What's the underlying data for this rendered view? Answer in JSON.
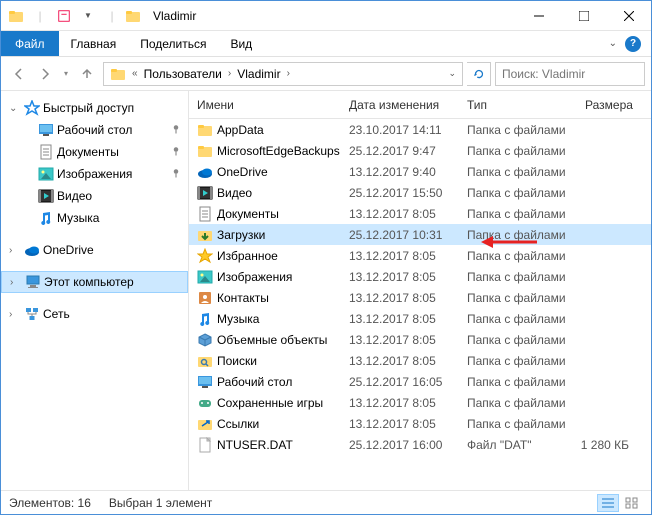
{
  "title": "Vladimir",
  "ribbon": {
    "file": "Файл",
    "tabs": [
      "Главная",
      "Поделиться",
      "Вид"
    ]
  },
  "breadcrumb": {
    "segments": [
      "Пользователи",
      "Vladimir"
    ]
  },
  "search": {
    "placeholder": "Поиск: Vladimir"
  },
  "sidebar": {
    "quick_access": "Быстрый доступ",
    "items": [
      {
        "label": "Рабочий стол",
        "pin": true,
        "icon": "desktop"
      },
      {
        "label": "Документы",
        "pin": true,
        "icon": "documents"
      },
      {
        "label": "Изображения",
        "pin": true,
        "icon": "pictures"
      },
      {
        "label": "Видео",
        "pin": false,
        "icon": "videos"
      },
      {
        "label": "Музыка",
        "pin": false,
        "icon": "music"
      }
    ],
    "onedrive": "OneDrive",
    "this_pc": "Этот компьютер",
    "network": "Сеть"
  },
  "columns": {
    "name": "Имени",
    "date": "Дата изменения",
    "type": "Тип",
    "size": "Размера"
  },
  "rows": [
    {
      "name": "AppData",
      "date": "23.10.2017 14:11",
      "type": "Папка с файлами",
      "size": "",
      "icon": "folder"
    },
    {
      "name": "MicrosoftEdgeBackups",
      "date": "25.12.2017 9:47",
      "type": "Папка с файлами",
      "size": "",
      "icon": "folder"
    },
    {
      "name": "OneDrive",
      "date": "13.12.2017 9:40",
      "type": "Папка с файлами",
      "size": "",
      "icon": "onedrive"
    },
    {
      "name": "Видео",
      "date": "25.12.2017 15:50",
      "type": "Папка с файлами",
      "size": "",
      "icon": "videos"
    },
    {
      "name": "Документы",
      "date": "13.12.2017 8:05",
      "type": "Папка с файлами",
      "size": "",
      "icon": "documents"
    },
    {
      "name": "Загрузки",
      "date": "25.12.2017 10:31",
      "type": "Папка с файлами",
      "size": "",
      "icon": "downloads",
      "selected": true
    },
    {
      "name": "Избранное",
      "date": "13.12.2017 8:05",
      "type": "Папка с файлами",
      "size": "",
      "icon": "favorites"
    },
    {
      "name": "Изображения",
      "date": "13.12.2017 8:05",
      "type": "Папка с файлами",
      "size": "",
      "icon": "pictures"
    },
    {
      "name": "Контакты",
      "date": "13.12.2017 8:05",
      "type": "Папка с файлами",
      "size": "",
      "icon": "contacts"
    },
    {
      "name": "Музыка",
      "date": "13.12.2017 8:05",
      "type": "Папка с файлами",
      "size": "",
      "icon": "music"
    },
    {
      "name": "Объемные объекты",
      "date": "13.12.2017 8:05",
      "type": "Папка с файлами",
      "size": "",
      "icon": "3dobjects"
    },
    {
      "name": "Поиски",
      "date": "13.12.2017 8:05",
      "type": "Папка с файлами",
      "size": "",
      "icon": "searches"
    },
    {
      "name": "Рабочий стол",
      "date": "25.12.2017 16:05",
      "type": "Папка с файлами",
      "size": "",
      "icon": "desktop"
    },
    {
      "name": "Сохраненные игры",
      "date": "13.12.2017 8:05",
      "type": "Папка с файлами",
      "size": "",
      "icon": "savedgames"
    },
    {
      "name": "Ссылки",
      "date": "13.12.2017 8:05",
      "type": "Папка с файлами",
      "size": "",
      "icon": "links"
    },
    {
      "name": "NTUSER.DAT",
      "date": "25.12.2017 16:00",
      "type": "Файл \"DAT\"",
      "size": "1 280 КБ",
      "icon": "file"
    }
  ],
  "status": {
    "count_label": "Элементов:",
    "count": "16",
    "selection": "Выбран 1 элемент"
  }
}
